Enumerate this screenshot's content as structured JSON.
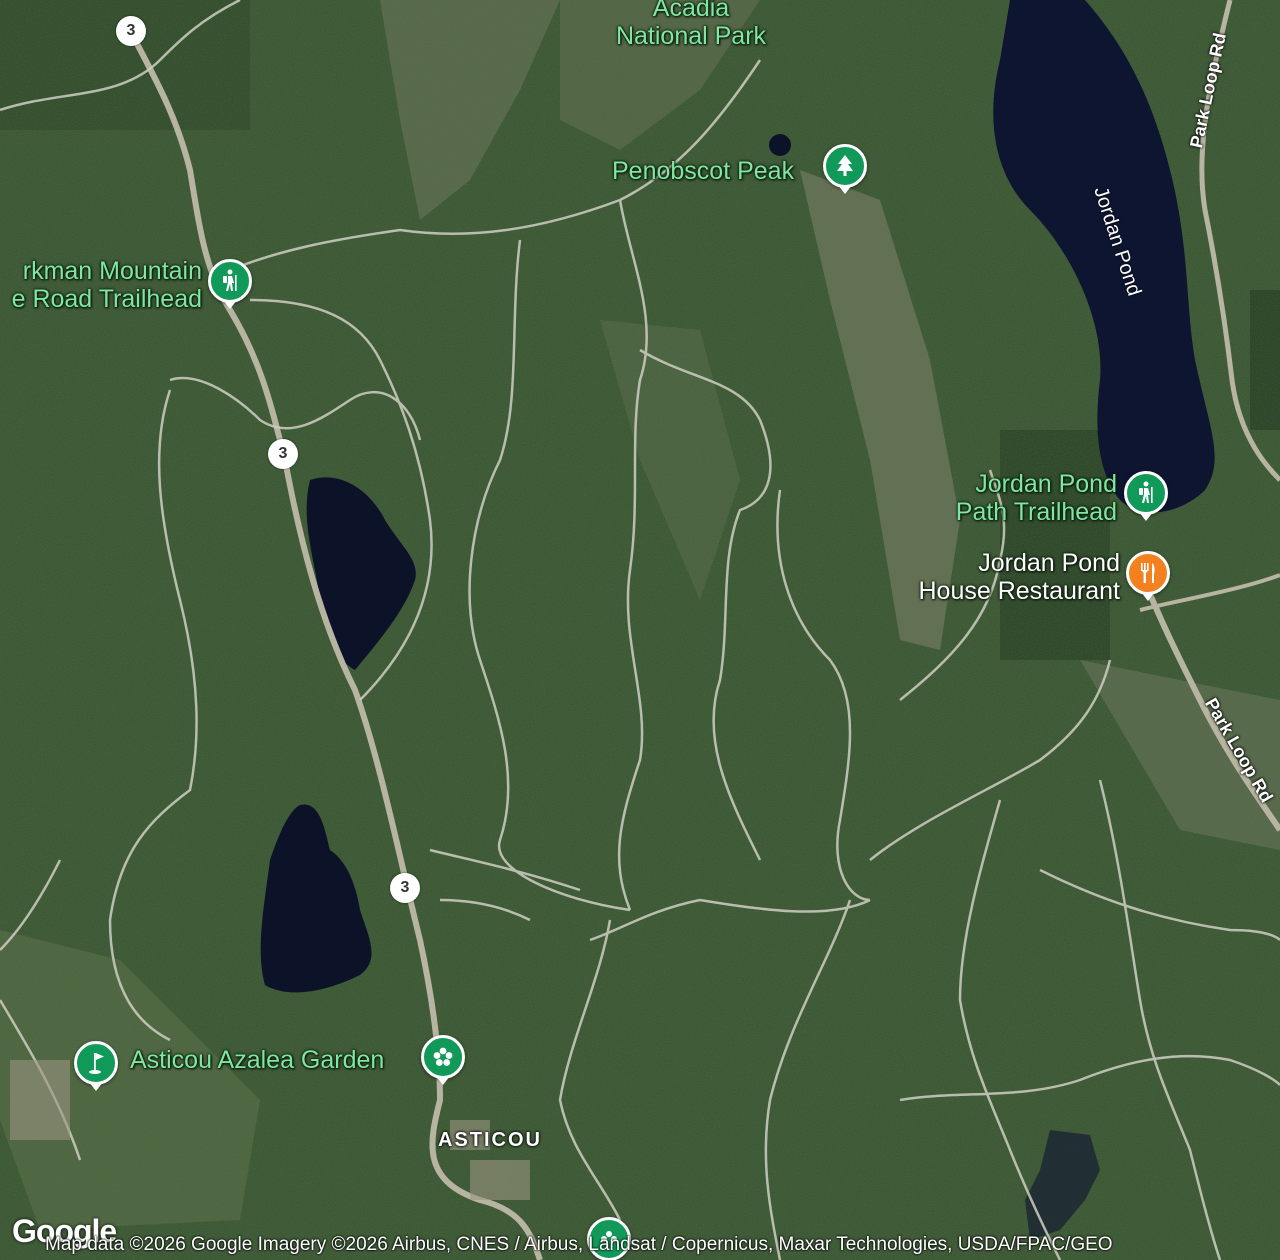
{
  "map": {
    "type": "satellite",
    "colors": {
      "forest": "#36512f",
      "forest_dark": "#253d22",
      "rock": "#8c8a78",
      "water": "#0d1530",
      "trail": "#cfcfc2",
      "road": "#b9b6a8",
      "poi_green": "#109959",
      "poi_orange": "#f3811f",
      "poi_label": "#7de8a0"
    }
  },
  "labels": {
    "park": "Acadia\nNational Park",
    "penobscot": "Penobscot Peak",
    "parkman": "rkman Mountain\ne Road Trailhead",
    "jordan_trailhead": "Jordan Pond\nPath Trailhead",
    "jordan_restaurant": "Jordan Pond\nHouse Restaurant",
    "azalea": "Asticou Azalea Garden",
    "town": "ASTICOU",
    "jordan_pond": "Jordan Pond",
    "park_loop_rd": "Park Loop Rd",
    "park_loop_rd_2": "Park Loop Rd",
    "route": "3",
    "watermark": "© 2026 Google"
  },
  "icons": {
    "penobscot": "tree-icon",
    "parkman": "hiker-icon",
    "jordan_trailhead": "hiker-icon",
    "jordan_restaurant": "restaurant-icon",
    "azalea": "flower-icon",
    "golf": "golf-icon"
  },
  "footer": {
    "logo": "Google",
    "attribution": "Map data ©2026 Google Imagery ©2026 Airbus, CNES / Airbus, Landsat / Copernicus, Maxar Technologies, USDA/FPAC/GEO"
  }
}
